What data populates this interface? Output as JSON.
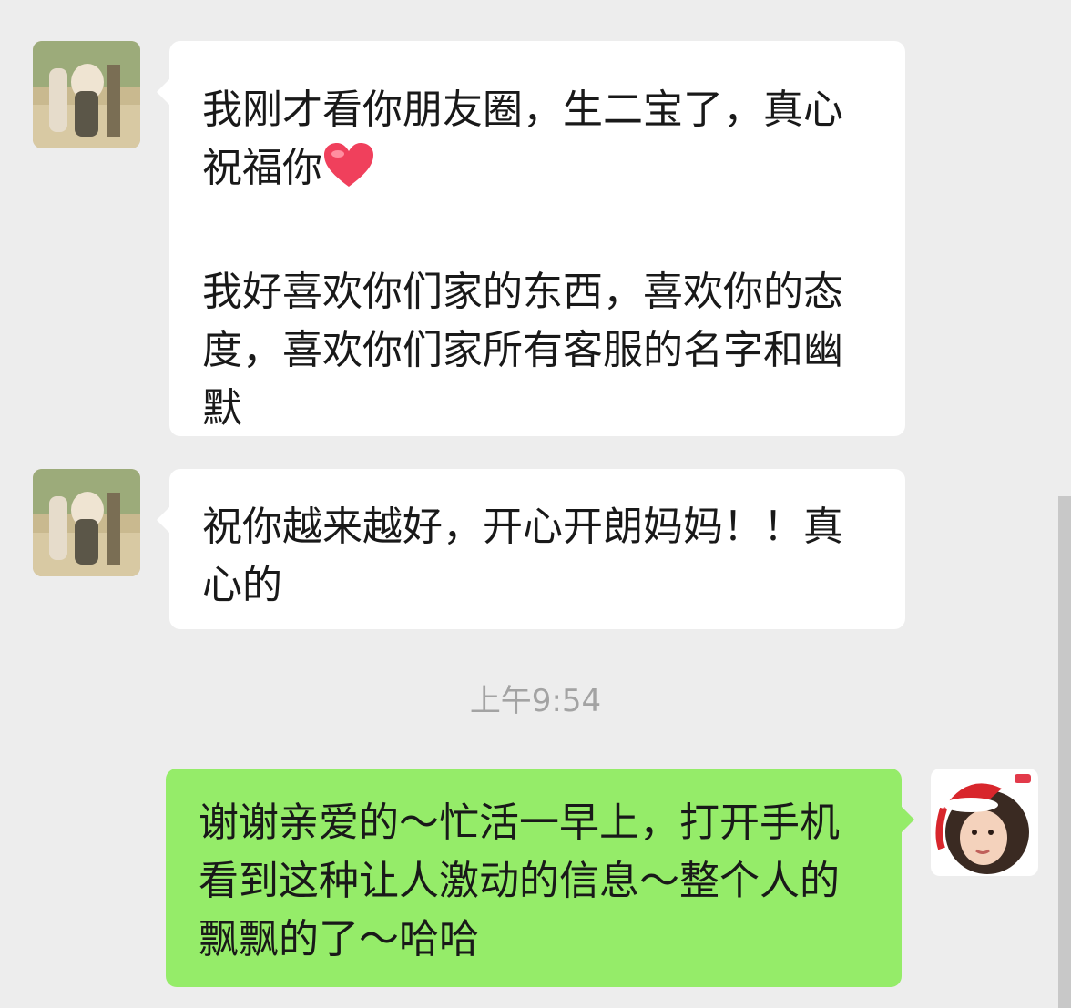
{
  "messages": [
    {
      "direction": "incoming",
      "avatar": "contact-photo-avatar",
      "text": "我刚才看你朋友圈，生二宝了，真心祝福你",
      "emoji": "red-heart-emoji",
      "text2": "我好喜欢你们家的东西，喜欢你的态度，喜欢你们家所有客服的名字和幽默"
    },
    {
      "direction": "incoming",
      "avatar": "contact-photo-avatar",
      "text": "祝你越来越好，开心开朗妈妈！！真心的"
    },
    {
      "direction": "outgoing",
      "avatar": "santa-hat-girl-avatar",
      "text": "谢谢亲爱的～忙活一早上，打开手机看到这种让人激动的信息～整个人的飘飘的了～哈哈"
    }
  ],
  "timestamp": "上午9:54",
  "colors": {
    "background": "#ededed",
    "incoming_bubble": "#ffffff",
    "outgoing_bubble": "#95ec69",
    "timestamp_text": "#a3a3a3"
  }
}
